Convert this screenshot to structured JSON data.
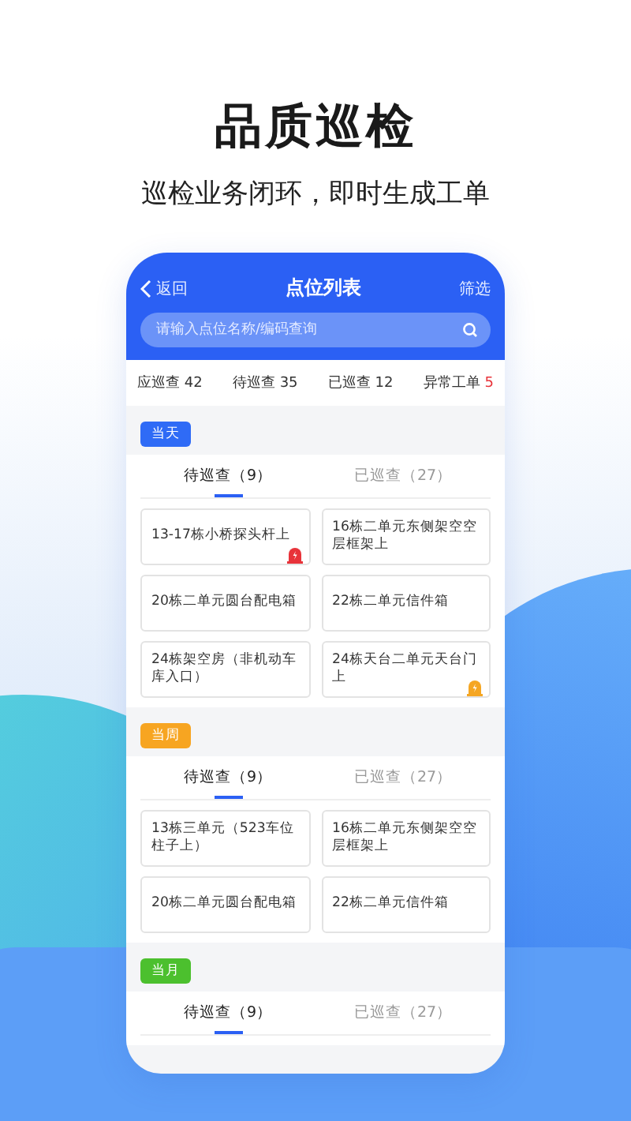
{
  "headline": "品质巡检",
  "subtitle": "巡检业务闭环，即时生成工单",
  "nav": {
    "back": "返回",
    "title": "点位列表",
    "filter": "筛选"
  },
  "search": {
    "placeholder": "请输入点位名称/编码查询"
  },
  "stats": [
    {
      "label": "应巡查",
      "count": "42",
      "alert": false
    },
    {
      "label": "待巡查",
      "count": "35",
      "alert": false
    },
    {
      "label": "已巡查",
      "count": "12",
      "alert": false
    },
    {
      "label": "异常工单",
      "count": "5",
      "alert": true
    }
  ],
  "sections": [
    {
      "tag": "当天",
      "color": "#2f6bf6",
      "tabs": [
        {
          "label": "待巡查（9）",
          "selected": true
        },
        {
          "label": "已巡查（27）",
          "selected": false
        }
      ],
      "cards": [
        {
          "text": "13-17栋小桥探头杆上",
          "color": "#e8333a"
        },
        {
          "text": "16栋二单元东侧架空空层框架上"
        },
        {
          "text": "20栋二单元圆台配电箱"
        },
        {
          "text": "22栋二单元信件箱"
        },
        {
          "text": "24栋架空房（非机动车库入口）"
        },
        {
          "text": "24栋天台二单元天台门上",
          "color": "#f5a623"
        }
      ]
    },
    {
      "tag": "当周",
      "color": "#f7a521",
      "tabs": [
        {
          "label": "待巡查（9）",
          "selected": true
        },
        {
          "label": "已巡查（27）",
          "selected": false
        }
      ],
      "cards": [
        {
          "text": "13栋三单元（523车位柱子上）"
        },
        {
          "text": "16栋二单元东侧架空空层框架上"
        },
        {
          "text": "20栋二单元圆台配电箱"
        },
        {
          "text": "22栋二单元信件箱"
        }
      ]
    },
    {
      "tag": "当月",
      "color": "#4cc02e",
      "tabs": [
        {
          "label": "待巡查（9）",
          "selected": true
        },
        {
          "label": "已巡查（27）",
          "selected": false
        }
      ]
    }
  ]
}
